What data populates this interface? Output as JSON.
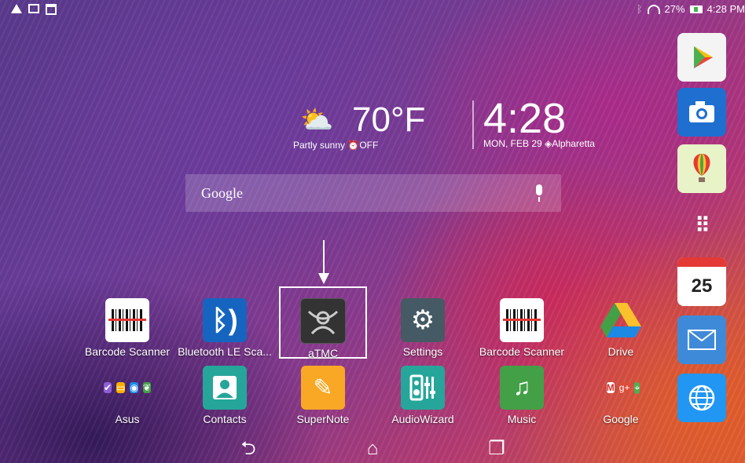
{
  "status_bar": {
    "battery": "27%",
    "time": "4:28 PM"
  },
  "weather": {
    "temperature": "70°F",
    "condition": "Partly sunny",
    "alarm": "⏰OFF"
  },
  "clock": {
    "time": "4:28",
    "date": "MON, FEB 29",
    "location": "Alpharetta"
  },
  "search": {
    "label": "Google"
  },
  "apps_row1": [
    {
      "label": "Barcode Scanner"
    },
    {
      "label": "Bluetooth LE Sca..."
    },
    {
      "label": "aTMC"
    },
    {
      "label": "Settings"
    },
    {
      "label": "Barcode Scanner"
    },
    {
      "label": "Drive"
    }
  ],
  "apps_row2": [
    {
      "label": "Asus"
    },
    {
      "label": "Contacts"
    },
    {
      "label": "SuperNote"
    },
    {
      "label": "AudioWizard"
    },
    {
      "label": "Music"
    },
    {
      "label": "Google"
    }
  ],
  "dock": {
    "calendar_day": "25"
  },
  "colors": {
    "accent_highlight": "#ffffff",
    "camera": "#1e6fd0",
    "email": "#3f8ad8",
    "browser": "#2196f3"
  }
}
